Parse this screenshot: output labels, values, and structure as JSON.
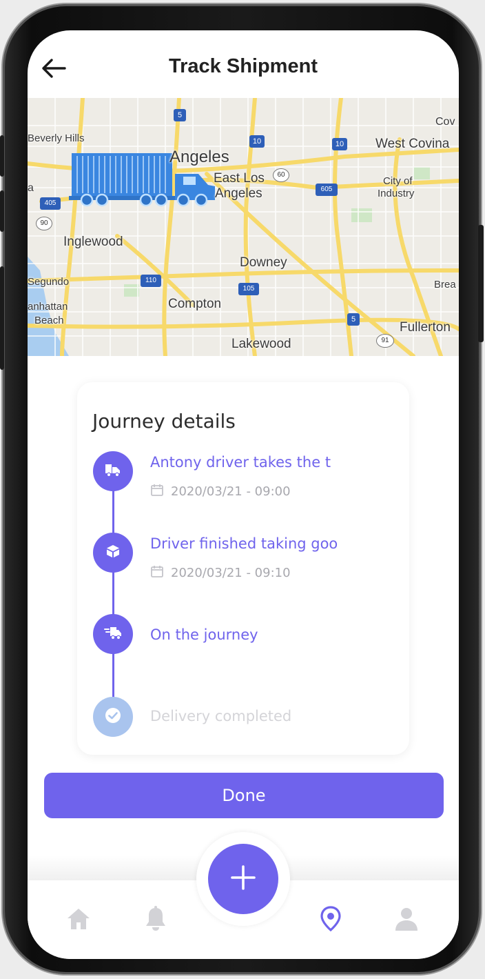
{
  "header": {
    "title": "Track Shipment"
  },
  "map": {
    "labels": {
      "beverly_hills": "Beverly Hills",
      "los_angeles": "Angeles",
      "west_covina": "West Covina",
      "covina": "Cov",
      "east_la_1": "East Los",
      "east_la_2": "Angeles",
      "city_of_1": "City of",
      "industry": "Industry",
      "inglewood": "Inglewood",
      "downey": "Downey",
      "segundo": "Segundo",
      "brea": "Brea",
      "manhattan": "anhattan",
      "beach": "Beach",
      "compton": "Compton",
      "fullerton": "Fullerton",
      "lakewood": "Lakewood",
      "left_a": "a"
    },
    "shields": {
      "s5a": "5",
      "s10a": "10",
      "s10b": "10",
      "s405": "405",
      "s605": "605",
      "s110": "110",
      "s105": "105",
      "s5b": "5",
      "s60": "60",
      "s90": "90",
      "s91": "91"
    }
  },
  "journey": {
    "title": "Journey details",
    "steps": [
      {
        "title": "Antony driver takes the t",
        "date": "2020/03/21 - 09:00",
        "icon": "truck-load-icon"
      },
      {
        "title": "Driver finished taking goo",
        "date": "2020/03/21 - 09:10",
        "icon": "package-icon"
      },
      {
        "title": "On the journey",
        "icon": "truck-moving-icon"
      },
      {
        "title": "Delivery completed",
        "icon": "check-icon"
      }
    ]
  },
  "done_label": "Done",
  "nav": {
    "items": [
      "home-icon",
      "bell-icon",
      "location-pin-icon",
      "user-icon"
    ],
    "active": "location-pin-icon"
  },
  "colors": {
    "accent": "#6f63ec",
    "pending": "#a9c4ee",
    "map_road": "#f7d96a",
    "truck": "#3a86e0"
  }
}
